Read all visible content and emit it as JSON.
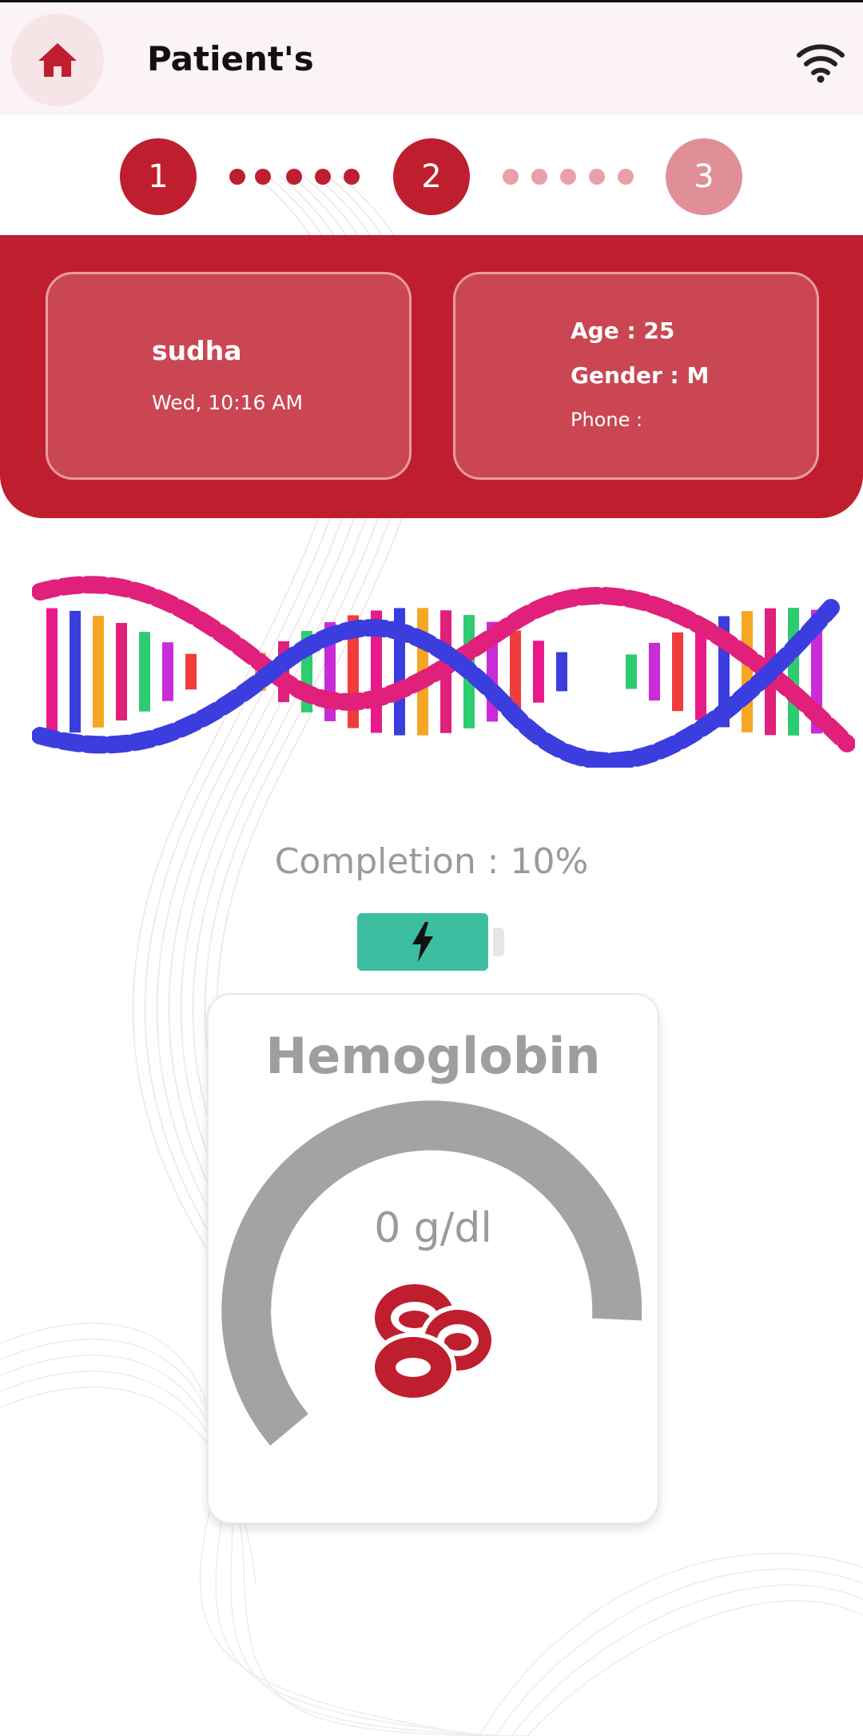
{
  "app": {
    "title": "Patient's",
    "home_icon": "home-icon",
    "wifi_icon": "wifi-icon"
  },
  "stepper": {
    "steps": [
      {
        "label": "1",
        "state": "active"
      },
      {
        "label": "2",
        "state": "active"
      },
      {
        "label": "3",
        "state": "inactive"
      }
    ]
  },
  "patient": {
    "name": "sudha",
    "datetime": "Wed, 10:16 AM",
    "age_line": "Age : 25",
    "gender_line": "Gender : M",
    "phone_line": "Phone :"
  },
  "completion": {
    "text": "Completion : 10%",
    "percent": 10,
    "battery_icon": "lightning-icon"
  },
  "hemoglobin": {
    "title": "Hemoglobin",
    "value_text": "0 g/dl",
    "value": 0,
    "icon": "red-blood-cells-icon"
  },
  "colors": {
    "primary": "#bf1e2e",
    "step_inactive": "#e08f97",
    "battery": "#3dbea1",
    "gauge_track": "#a3a3a3",
    "muted_text": "#9a9a9a"
  }
}
